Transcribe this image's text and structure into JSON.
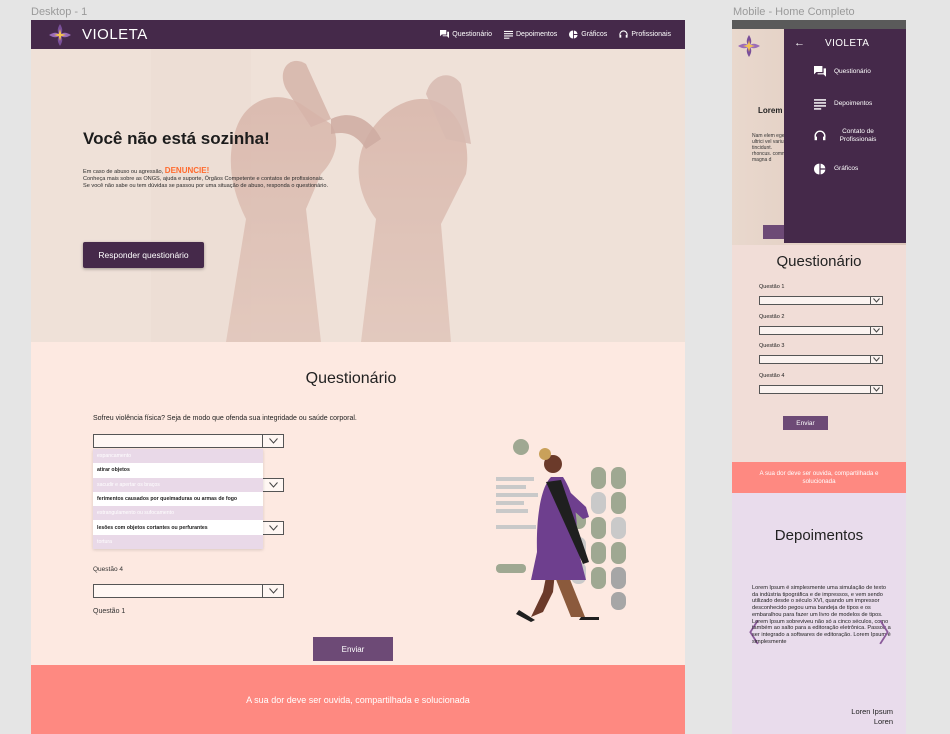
{
  "frames": {
    "desktop_label": "Desktop - 1",
    "mobile_label": "Mobile - Home Completo"
  },
  "colors": {
    "nav": "#45294a",
    "accent_button": "#6d4a76",
    "banner": "#fe8981",
    "denuncie": "#ff6a2e",
    "questionnaire_bg": "#fde9e1",
    "depoimentos_bg": "#e9dcec"
  },
  "desktop": {
    "brand": "VIOLETA",
    "menu": [
      {
        "label": "Questionário",
        "icon": "chat-icon"
      },
      {
        "label": "Depoimentos",
        "icon": "text-lines-icon"
      },
      {
        "label": "Gráficos",
        "icon": "pie-chart-icon"
      },
      {
        "label": "Profissionais",
        "icon": "headset-icon"
      }
    ],
    "hero": {
      "title": "Você não está sozinha!",
      "line1_prefix": "Em caso de abuso ou agressão, ",
      "line1_link": "DENUNCIE!",
      "line2": "Conheça mais sobre as ONGS, ajuda e suporte, Órgãos Competente e contatos de profissionais.",
      "line3": "Se você não sabe ou tem dúvidas se passou por uma situação de abuso, responda o questionário.",
      "button": "Responder questionário"
    },
    "questionnaire": {
      "title": "Questionário",
      "question1": "Sofreu violência física? Seja de modo que ofenda sua integridade ou saúde corporal.",
      "dropdown_options": [
        {
          "label": "espancamento",
          "style": "light"
        },
        {
          "label": "atirar objetos",
          "style": "dark"
        },
        {
          "label": "sacudir e apertar os braços",
          "style": "light"
        },
        {
          "label": "ferimentos causados por queimaduras ou armas de fogo",
          "style": "dark"
        },
        {
          "label": "estrangulamento ou sufocamento",
          "style": "light"
        },
        {
          "label": "lesões com objetos cortantes ou perfurantes",
          "style": "dark"
        },
        {
          "label": "tortura",
          "style": "light"
        }
      ],
      "question4_label": "Questão 4",
      "question1_label": "Questão 1",
      "send_button": "Enviar"
    },
    "banner": "A sua dor deve ser ouvida, compartilhada e solucionada"
  },
  "mobile": {
    "hero_title": "Lorem",
    "hero_text": "Nam elem eget ultrici vel variu tincidunt. rhoncus. commod magna d",
    "drawer": {
      "back": "←",
      "title": "VIOLETA",
      "items": [
        {
          "label": "Questionário",
          "icon": "chat-icon"
        },
        {
          "label": "Depoimentos",
          "icon": "text-lines-icon"
        },
        {
          "label": "Contato de Profissionais",
          "icon": "headset-icon"
        },
        {
          "label": "Gráficos",
          "icon": "pie-chart-icon"
        }
      ]
    },
    "questionnaire": {
      "title": "Questionário",
      "questions": [
        "Questão 1",
        "Questão 2",
        "Questão 3",
        "Questão 4"
      ],
      "send_button": "Enviar"
    },
    "banner": "A sua dor deve ser ouvida, compartilhada e solucionada",
    "depoimentos": {
      "title": "Depoimentos",
      "text": "Lorem Ipsum é simplesmente uma simulação de texto da indústria tipográfica e de impressos, e vem sendo utilizado desde o século XVI, quando um impressor desconhecido pegou uma bandeja de tipos e os embaralhou para fazer um livro de modelos de tipos. Lorem Ipsum sobreviveu não só a cinco séculos, como também ao salto para a editoração eletrônica. Passou a ser integrado a softwares de editoração. Lorem Ipsum é simplesmente",
      "prev": "〈",
      "next": "〉",
      "author_name": "Loren Ipsum",
      "author_sub": "Loren"
    }
  }
}
